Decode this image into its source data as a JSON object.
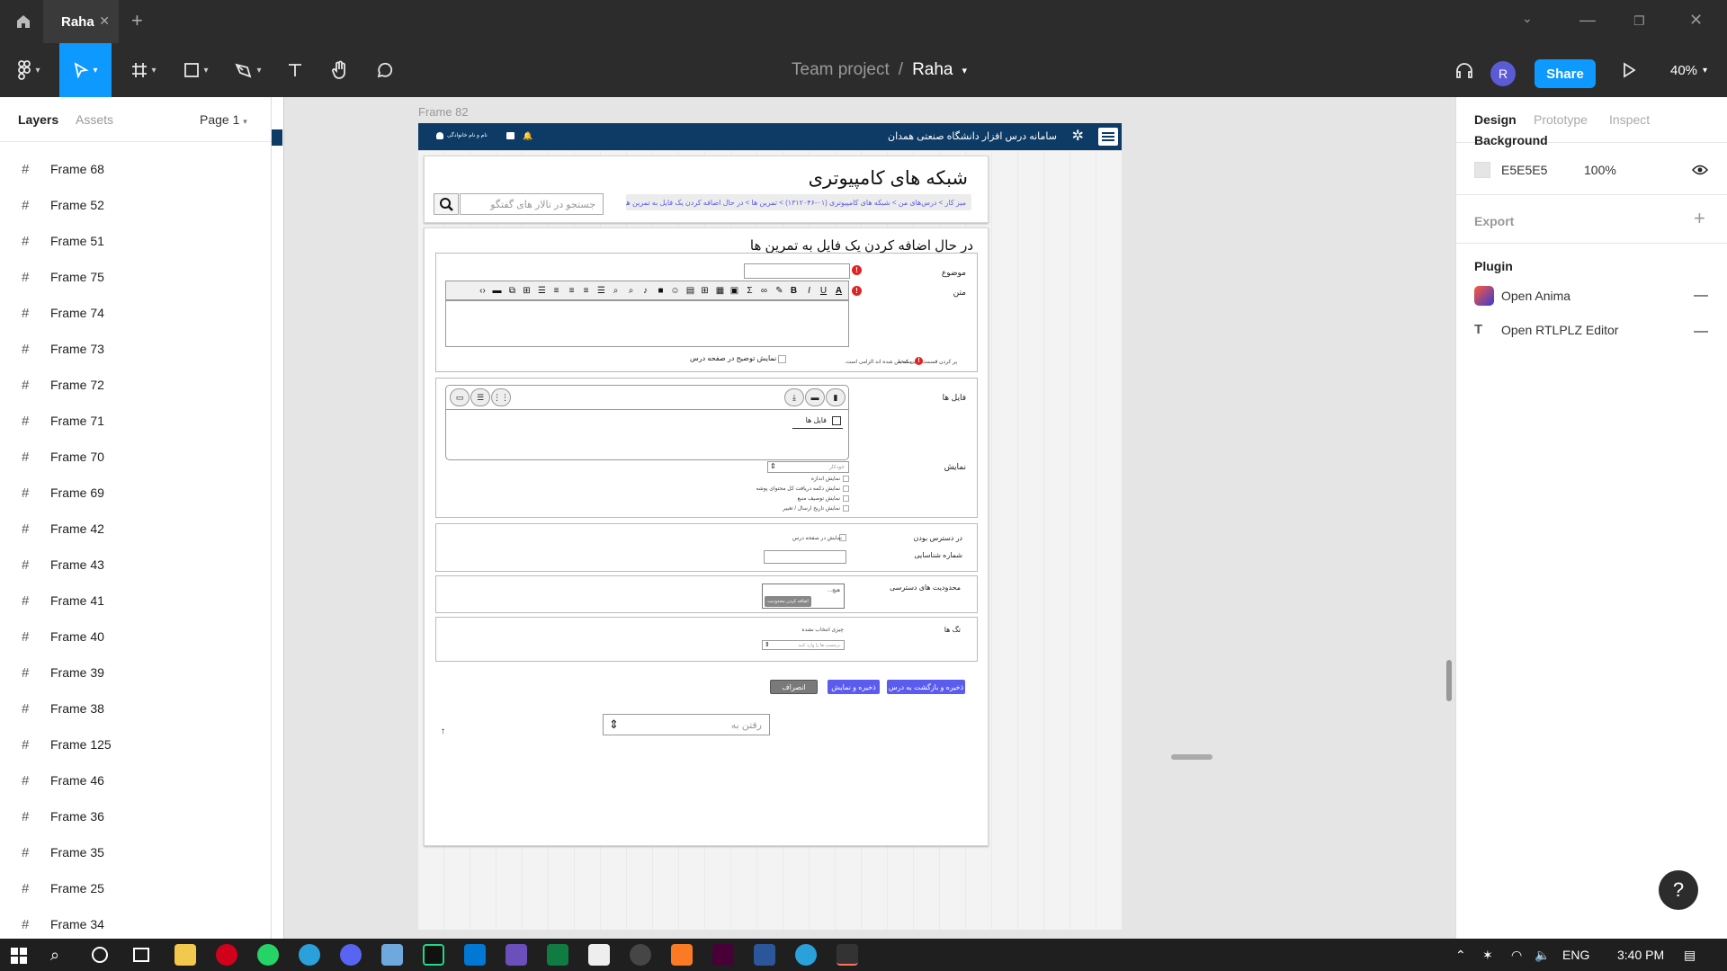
{
  "tab": {
    "title": "Raha"
  },
  "toolbar": {
    "project": "Team project",
    "separator": "/",
    "file": "Raha",
    "share": "Share",
    "avatar": "R",
    "zoom": "40%"
  },
  "left_panel": {
    "tabs": [
      "Layers",
      "Assets"
    ],
    "page": "Page 1",
    "layers": [
      "Frame 68",
      "Frame 52",
      "Frame 51",
      "Frame 75",
      "Frame 74",
      "Frame 73",
      "Frame 72",
      "Frame 71",
      "Frame 70",
      "Frame 69",
      "Frame 42",
      "Frame 43",
      "Frame 41",
      "Frame 40",
      "Frame 39",
      "Frame 38",
      "Frame 125",
      "Frame 46",
      "Frame 36",
      "Frame 35",
      "Frame 25",
      "Frame 34"
    ]
  },
  "canvas": {
    "frame_label": "Frame 82",
    "site": {
      "header_title": "سامانه درس افزار دانشگاه صنعتی همدان",
      "user_name": "نام و نام خانوادگی",
      "page_title": "شبکه های کامپیوتری",
      "breadcrumb": "میز کار > درس‌های من > شبکه های کامپیوتری (۰۱-۱۳۱۲۰۴۶) > تمرین ها > در حال اضافه کردن یک فایل به تمرین ها",
      "search_placeholder": "جستجو در تالار های گفتگو",
      "form_title": "در حال اضافه کردن یک فایل به تمرین ها",
      "subject_label": "موضوع",
      "text_label": "متن",
      "required_note": "پر کردن قسمت هایی که با",
      "required_note2": "مشخص شده اند الزامی است.",
      "show_desc_label": "نمایش توضیح در صفحه درس",
      "files_label": "فایل ها",
      "files_folder": "فایل ها",
      "display_label": "نمایش",
      "display_select": "خودکار",
      "display_options": [
        "نمایش اندازه",
        "نمایش دکمه دریافت کل محتوای پوشه",
        "نمایش توصیف منبع",
        "نمایش تاریخ ارسال / تغییر"
      ],
      "availability_label": "در دسترس بودن",
      "show_on_course": "نمایش در صفحه درس",
      "id_label": "شماره شناسایی",
      "restrictions_label": "محدودیت های دسترسی",
      "restrictions_none": "هیچ...",
      "add_restriction": "اضافه کردن محدودیت",
      "tags_label": "تگ ها",
      "tags_none": "چیزی انتخاب نشده",
      "tags_placeholder": "برچسب ها را وارد کنید",
      "btn_save_return": "ذخیره و بازگشت به درس",
      "btn_save_show": "ذخیره و نمایش",
      "btn_cancel": "انصراف",
      "goto_placeholder": "رفتن به"
    }
  },
  "right_panel": {
    "tabs": [
      "Design",
      "Prototype",
      "Inspect"
    ],
    "background_label": "Background",
    "background_hex": "E5E5E5",
    "background_opacity": "100%",
    "export_label": "Export",
    "plugin_label": "Plugin",
    "plugins": [
      "Open Anima",
      "Open RTLPLZ Editor"
    ]
  },
  "taskbar": {
    "lang": "ENG",
    "time": "3:40 PM"
  },
  "colors": {
    "share": "#0d99ff",
    "site_header": "#0d3b66",
    "primary_btn": "#5b5bf0",
    "cancel_btn": "#7a7a7a",
    "required": "#e02424"
  }
}
